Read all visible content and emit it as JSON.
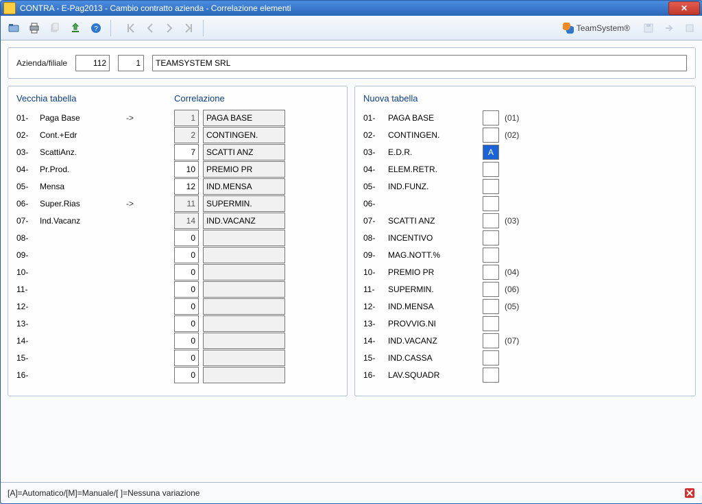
{
  "window": {
    "title": "CONTRA  -  E-Pag2013  -  Cambio contratto azienda - Correlazione elementi"
  },
  "brand": {
    "name": "TeamSystem®"
  },
  "header": {
    "label": "Azienda/filiale",
    "code1": "112",
    "code2": "1",
    "company": "TEAMSYSTEM SRL"
  },
  "left": {
    "old_title": "Vecchia tabella",
    "corr_title": "Correlazione",
    "rows": [
      {
        "idx": "01-",
        "desc": "Paga Base",
        "arrow": "->",
        "num": "1",
        "text": "PAGA BASE",
        "numActive": false
      },
      {
        "idx": "02-",
        "desc": "Cont.+Edr",
        "arrow": "",
        "num": "2",
        "text": "CONTINGEN.",
        "numActive": false
      },
      {
        "idx": "03-",
        "desc": "ScattiAnz.",
        "arrow": "",
        "num": "7",
        "text": "SCATTI ANZ",
        "numActive": true
      },
      {
        "idx": "04-",
        "desc": "Pr.Prod.",
        "arrow": "",
        "num": "10",
        "text": "PREMIO PR",
        "numActive": true
      },
      {
        "idx": "05-",
        "desc": "Mensa",
        "arrow": "",
        "num": "12",
        "text": "IND.MENSA",
        "numActive": true
      },
      {
        "idx": "06-",
        "desc": "Super.Rias",
        "arrow": "->",
        "num": "11",
        "text": "SUPERMIN.",
        "numActive": false
      },
      {
        "idx": "07-",
        "desc": "Ind.Vacanz",
        "arrow": "",
        "num": "14",
        "text": "IND.VACANZ",
        "numActive": false
      },
      {
        "idx": "08-",
        "desc": "",
        "arrow": "",
        "num": "0",
        "text": "",
        "numActive": true
      },
      {
        "idx": "09-",
        "desc": "",
        "arrow": "",
        "num": "0",
        "text": "",
        "numActive": true
      },
      {
        "idx": "10-",
        "desc": "",
        "arrow": "",
        "num": "0",
        "text": "",
        "numActive": true
      },
      {
        "idx": "11-",
        "desc": "",
        "arrow": "",
        "num": "0",
        "text": "",
        "numActive": true
      },
      {
        "idx": "12-",
        "desc": "",
        "arrow": "",
        "num": "0",
        "text": "",
        "numActive": true
      },
      {
        "idx": "13-",
        "desc": "",
        "arrow": "",
        "num": "0",
        "text": "",
        "numActive": true
      },
      {
        "idx": "14-",
        "desc": "",
        "arrow": "",
        "num": "0",
        "text": "",
        "numActive": true
      },
      {
        "idx": "15-",
        "desc": "",
        "arrow": "",
        "num": "0",
        "text": "",
        "numActive": true
      },
      {
        "idx": "16-",
        "desc": "",
        "arrow": "",
        "num": "0",
        "text": "",
        "numActive": true
      }
    ]
  },
  "right": {
    "title": "Nuova tabella",
    "rows": [
      {
        "idx": "01-",
        "desc": "PAGA BASE",
        "box": "",
        "hl": false,
        "ref": "(01)"
      },
      {
        "idx": "02-",
        "desc": "CONTINGEN.",
        "box": "",
        "hl": false,
        "ref": "(02)"
      },
      {
        "idx": "03-",
        "desc": "E.D.R.",
        "box": "A",
        "hl": true,
        "ref": ""
      },
      {
        "idx": "04-",
        "desc": "ELEM.RETR.",
        "box": "",
        "hl": false,
        "ref": ""
      },
      {
        "idx": "05-",
        "desc": "IND.FUNZ.",
        "box": "",
        "hl": false,
        "ref": ""
      },
      {
        "idx": "06-",
        "desc": "",
        "box": "",
        "hl": false,
        "ref": ""
      },
      {
        "idx": "07-",
        "desc": "SCATTI ANZ",
        "box": "",
        "hl": false,
        "ref": "(03)"
      },
      {
        "idx": "08-",
        "desc": "INCENTIVO",
        "box": "",
        "hl": false,
        "ref": ""
      },
      {
        "idx": "09-",
        "desc": "MAG.NOTT.%",
        "box": "",
        "hl": false,
        "ref": ""
      },
      {
        "idx": "10-",
        "desc": "PREMIO PR",
        "box": "",
        "hl": false,
        "ref": "(04)"
      },
      {
        "idx": "11-",
        "desc": "SUPERMIN.",
        "box": "",
        "hl": false,
        "ref": "(06)"
      },
      {
        "idx": "12-",
        "desc": "IND.MENSA",
        "box": "",
        "hl": false,
        "ref": "(05)"
      },
      {
        "idx": "13-",
        "desc": "PROVVIG.NI",
        "box": "",
        "hl": false,
        "ref": ""
      },
      {
        "idx": "14-",
        "desc": "IND.VACANZ",
        "box": "",
        "hl": false,
        "ref": "(07)"
      },
      {
        "idx": "15-",
        "desc": "IND.CASSA",
        "box": "",
        "hl": false,
        "ref": ""
      },
      {
        "idx": "16-",
        "desc": "LAV.SQUADR",
        "box": "",
        "hl": false,
        "ref": ""
      }
    ]
  },
  "status": {
    "hint": "[A]=Automatico/[M]=Manuale/[ ]=Nessuna variazione"
  }
}
